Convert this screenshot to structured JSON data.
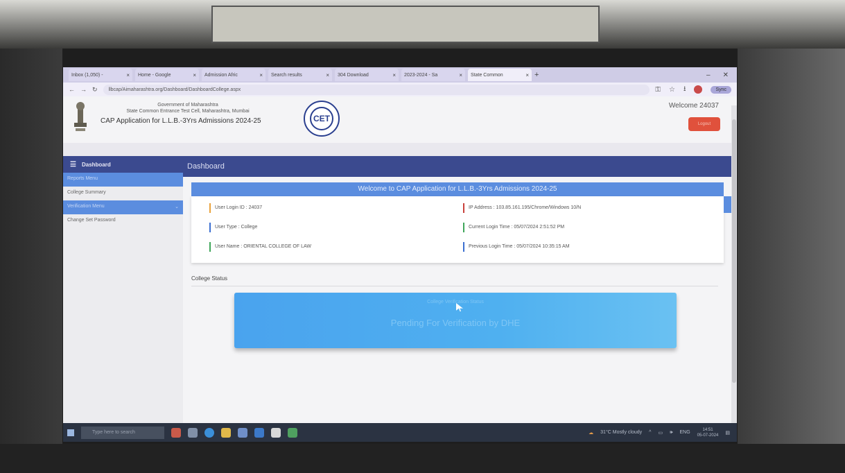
{
  "browser": {
    "tabs": [
      {
        "label": "Inbox (1,050) -"
      },
      {
        "label": "Home - Google"
      },
      {
        "label": "Admission Afric"
      },
      {
        "label": "Search results"
      },
      {
        "label": "304 Download"
      },
      {
        "label": "2023-2024 - Sa"
      },
      {
        "label": "State Common"
      }
    ],
    "new_tab": "+",
    "url": "llbcap/Aimaharashtra.org/Dashboard/DashboardCollege.aspx",
    "sync_label": "Sync"
  },
  "header": {
    "gov_line1": "Government of Maharashtra",
    "gov_line2": "State Common Entrance Test Cell, Maharashtra, Mumbai",
    "app_title": "CAP Application for L.L.B.-3Yrs Admissions 2024-25",
    "logo_text": "CET",
    "welcome": "Welcome 24037",
    "logout": "Logout"
  },
  "sidebar": {
    "title": "Dashboard",
    "items": [
      {
        "label": "Reports Menu"
      },
      {
        "label": "College Summary"
      },
      {
        "label": "Verification Menu"
      },
      {
        "label": "Change Set Password"
      }
    ]
  },
  "main": {
    "title": "Dashboard",
    "welcome_bar": "Welcome to CAP Application for L.L.B.-3Yrs Admissions 2024-25",
    "info": {
      "user_login_id": "User Login ID : 24037",
      "user_type": "User Type : College",
      "user_name": "User Name : ORIENTAL COLLEGE OF LAW",
      "ip_address": "IP Address : 103.85.161.195/Chrome/Windows 10/N",
      "current_login": "Current Login Time : 05/07/2024 2:51:52 PM",
      "previous_login": "Previous Login Time : 05/07/2024 10:35:15 AM"
    },
    "college_status_label": "College Status",
    "status_small": "College Verification Status",
    "status_main": "Pending For Verification by DHE"
  },
  "taskbar": {
    "search_placeholder": "Type here to search",
    "weather": "31°C Mostly cloudy",
    "lang": "ENG",
    "time": "14:51",
    "date": "05-07-2024"
  },
  "colors": {
    "nav": "#3b4a8f",
    "accent": "#5b8ddf",
    "logout": "#e0513c"
  }
}
